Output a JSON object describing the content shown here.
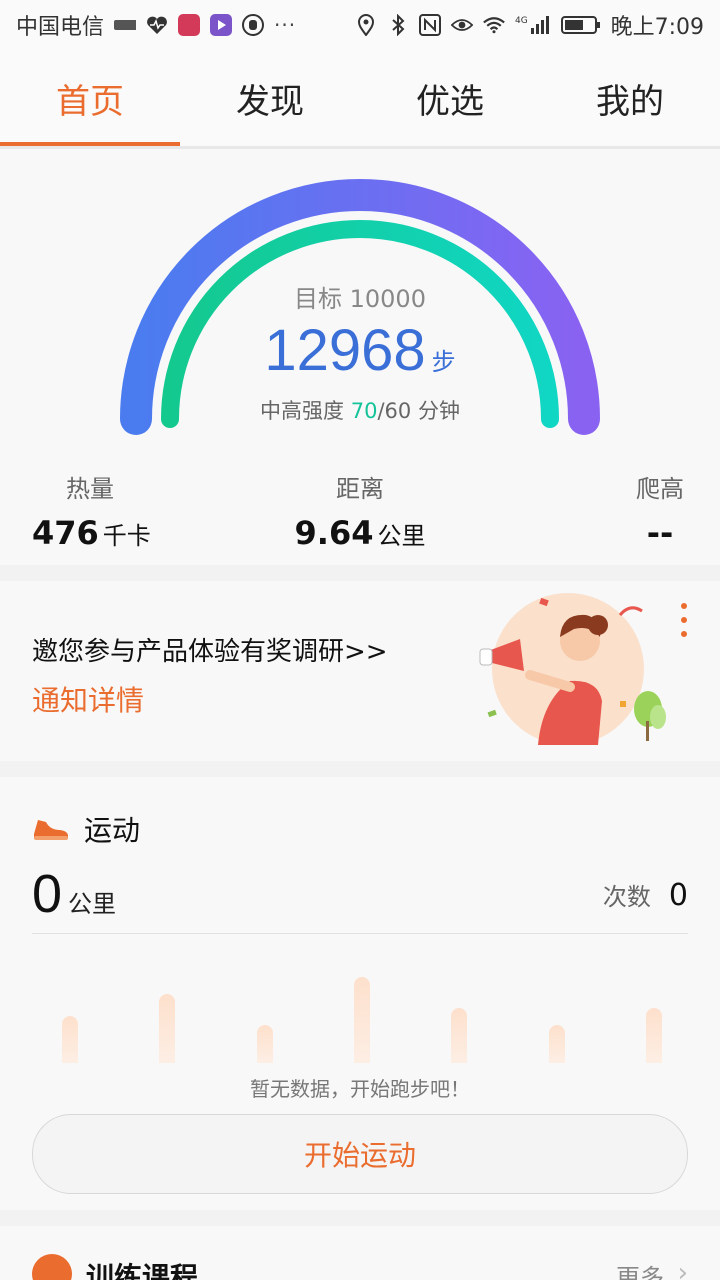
{
  "status_bar": {
    "carrier": "中国电信",
    "time": "晚上7:09",
    "network": "4G",
    "icons": [
      "app-badge-icon",
      "heart-rate-icon",
      "huawei-icon",
      "video-icon",
      "hand-icon",
      "more-dots-icon",
      "location-icon",
      "bluetooth-icon",
      "nfc-icon",
      "eye-icon",
      "wifi-icon",
      "signal-icon",
      "battery-icon"
    ],
    "more": "···"
  },
  "tabs": [
    {
      "label": "首页",
      "active": true
    },
    {
      "label": "发现",
      "active": false
    },
    {
      "label": "优选",
      "active": false
    },
    {
      "label": "我的",
      "active": false
    }
  ],
  "steps": {
    "target_label": "目标 10000",
    "value": "12968",
    "unit": "步",
    "intensity_label": "中高强度",
    "intensity_value": "70",
    "intensity_goal": "/60 分钟",
    "progress": 1.0
  },
  "stats": {
    "calories": {
      "label": "热量",
      "value": "476",
      "unit": "千卡"
    },
    "distance": {
      "label": "距离",
      "value": "9.64",
      "unit": "公里"
    },
    "climb": {
      "label": "爬高",
      "value": "--",
      "unit": ""
    }
  },
  "survey": {
    "title": "邀您参与产品体验有奖调研>>",
    "link": "通知详情"
  },
  "sport": {
    "title": "运动",
    "distance_value": "0",
    "distance_unit": "公里",
    "count_label": "次数",
    "count_value": "0",
    "empty_text": "暂无数据，开始跑步吧！",
    "start_button": "开始运动",
    "placeholder_bars": [
      0.42,
      0.62,
      0.34,
      0.77,
      0.49,
      0.34,
      0.49
    ]
  },
  "training": {
    "title": "训练课程",
    "more": "更多"
  },
  "colors": {
    "accent": "#ea6d2f",
    "steps_blue": "#3b6fd8",
    "intensity_green": "#15c39a"
  }
}
